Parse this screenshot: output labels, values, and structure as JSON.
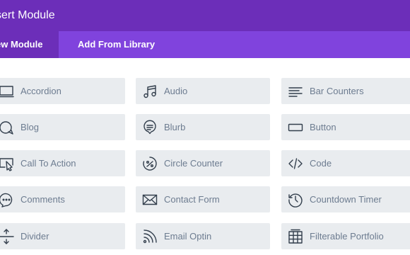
{
  "dialog": {
    "title": "sert Module"
  },
  "tabs": {
    "new_module": "ew Module",
    "add_from_library": "Add From Library"
  },
  "modules": [
    {
      "label": "Accordion",
      "icon": "accordion-icon"
    },
    {
      "label": "Audio",
      "icon": "audio-icon"
    },
    {
      "label": "Bar Counters",
      "icon": "bar-counters-icon"
    },
    {
      "label": "Blog",
      "icon": "blog-icon"
    },
    {
      "label": "Blurb",
      "icon": "blurb-icon"
    },
    {
      "label": "Button",
      "icon": "button-icon"
    },
    {
      "label": "Call To Action",
      "icon": "call-to-action-icon"
    },
    {
      "label": "Circle Counter",
      "icon": "circle-counter-icon"
    },
    {
      "label": "Code",
      "icon": "code-icon"
    },
    {
      "label": "Comments",
      "icon": "comments-icon"
    },
    {
      "label": "Contact Form",
      "icon": "contact-form-icon"
    },
    {
      "label": "Countdown Timer",
      "icon": "countdown-timer-icon"
    },
    {
      "label": "Divider",
      "icon": "divider-icon"
    },
    {
      "label": "Email Optin",
      "icon": "email-optin-icon"
    },
    {
      "label": "Filterable Portfolio",
      "icon": "filterable-portfolio-icon"
    }
  ],
  "colors": {
    "header": "#6c2eb9",
    "tabbar": "#8043dd",
    "module_bg": "#e9ecef",
    "module_text": "#6d7c90"
  }
}
